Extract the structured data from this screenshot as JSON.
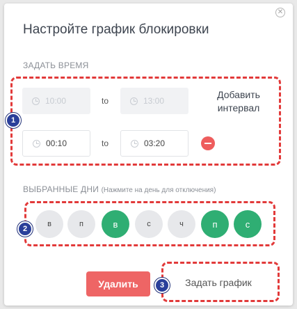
{
  "dialog": {
    "title": "Настройте график блокировки",
    "close_icon": "close-icon"
  },
  "time_section": {
    "label": "ЗАДАТЬ ВРЕМЯ",
    "rows": [
      {
        "from": "10:00",
        "to_label": "to",
        "to": "13:00",
        "state": "placeholder"
      },
      {
        "from": "00:10",
        "to_label": "to",
        "to": "03:20",
        "state": "filled"
      }
    ],
    "add_interval": "Добавить интервал",
    "remove_icon": "minus-circle-icon"
  },
  "days_section": {
    "label": "ВЫБРАННЫЕ ДНИ",
    "hint": "(Нажмите на день для отключения)",
    "days": [
      {
        "label": "в",
        "selected": false
      },
      {
        "label": "п",
        "selected": false
      },
      {
        "label": "в",
        "selected": true
      },
      {
        "label": "с",
        "selected": false
      },
      {
        "label": "ч",
        "selected": false
      },
      {
        "label": "п",
        "selected": true
      },
      {
        "label": "с",
        "selected": true
      }
    ]
  },
  "footer": {
    "delete_label": "Удалить",
    "schedule_label": "Задать график"
  },
  "annotations": {
    "badges": [
      "1",
      "2",
      "3"
    ],
    "highlight_color": "#e23a3a",
    "badge_color": "#2a3f9a"
  },
  "colors": {
    "selected_day": "#2fae73",
    "unselected_day": "#e7e8eb",
    "delete_button": "#ee6565"
  }
}
